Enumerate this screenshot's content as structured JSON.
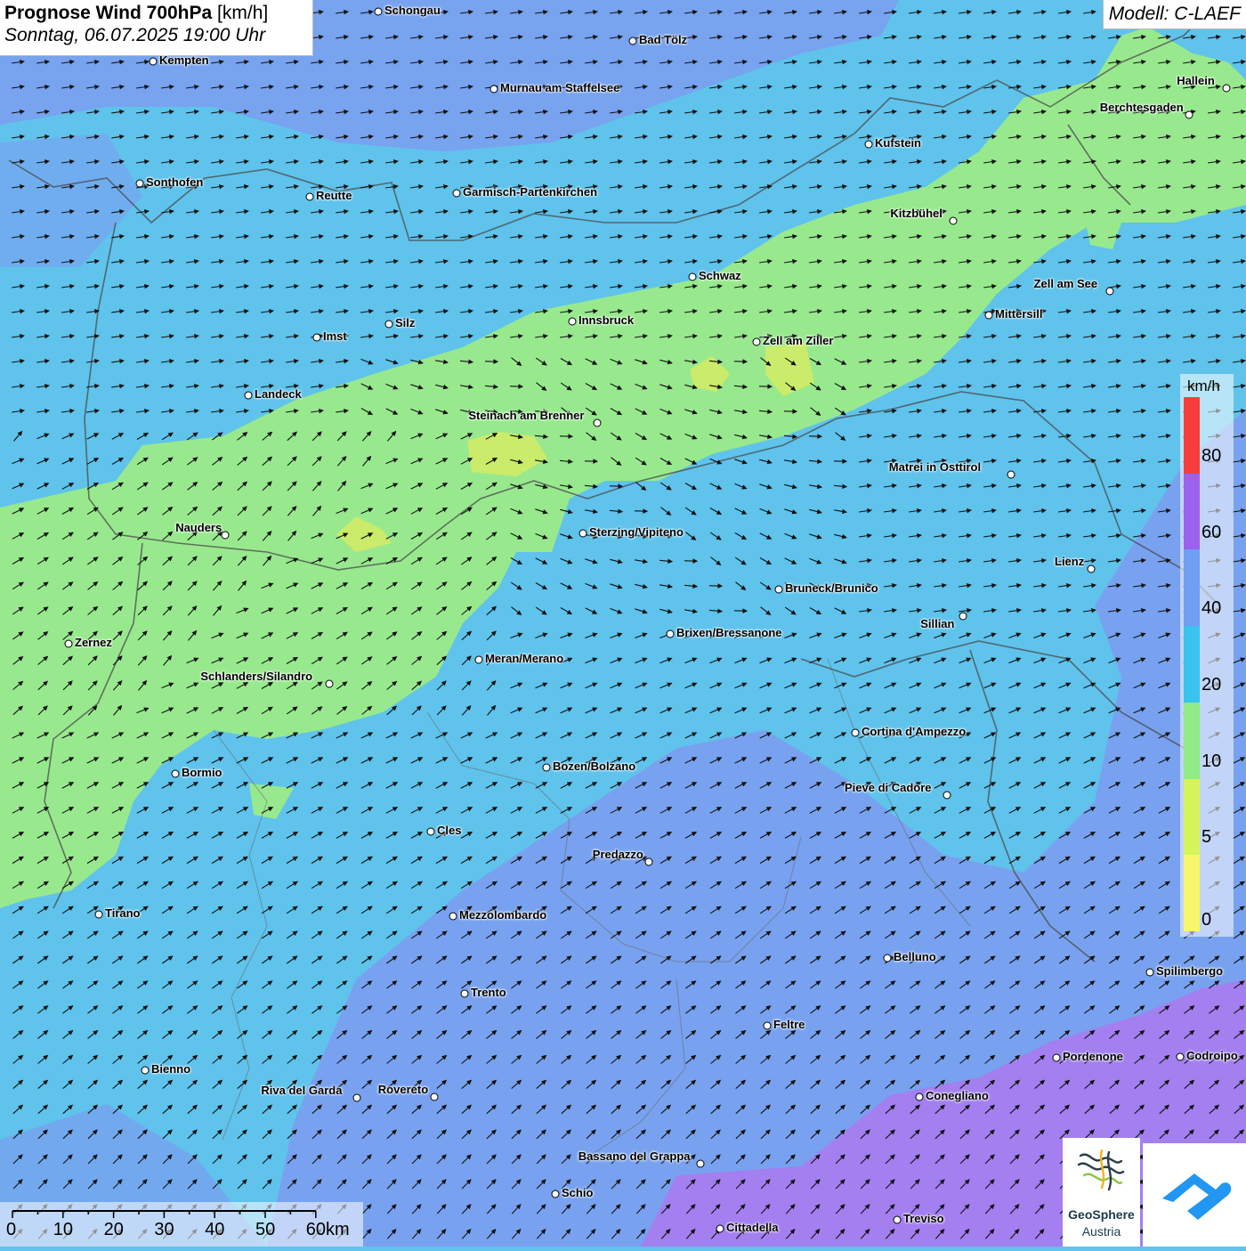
{
  "title": {
    "bold": "Prognose Wind 700hPa",
    "unit": "[km/h]",
    "date": "Sonntag, 06.07.2025 19:00 Uhr"
  },
  "model": "Modell: C-LAEF",
  "legend": {
    "unit": "km/h",
    "labels": [
      "80",
      "60",
      "40",
      "20",
      "10",
      "5",
      "0"
    ],
    "colors": [
      "#f73c3c",
      "#9a62ee",
      "#6f9ff2",
      "#39c4ef",
      "#8fec87",
      "#d5f55a",
      "#f8f66a"
    ]
  },
  "scale": {
    "labels": [
      "0",
      "10",
      "20",
      "30",
      "40",
      "50",
      "60km"
    ]
  },
  "background_colors": {
    "cyan": "#5fc3ec",
    "blue": "#7b9ef0",
    "green": "#98e98e",
    "yellowgreen": "#cbeb6a",
    "violet": "#a37ff0"
  },
  "cities": [
    {
      "name": "Schongau"
    },
    {
      "name": "Bad Tölz"
    },
    {
      "name": "Kempten"
    },
    {
      "name": "Murnau am Staffelsee"
    },
    {
      "name": "Hallein"
    },
    {
      "name": "Berchtesgaden"
    },
    {
      "name": "Kufstein"
    },
    {
      "name": "Sonthofen"
    },
    {
      "name": "Reutte"
    },
    {
      "name": "Garmisch-Partenkirchen"
    },
    {
      "name": "Kitzbühel"
    },
    {
      "name": "Schwaz"
    },
    {
      "name": "Zell am See"
    },
    {
      "name": "Innsbruck"
    },
    {
      "name": "Mittersill"
    },
    {
      "name": "Silz"
    },
    {
      "name": "Imst"
    },
    {
      "name": "Zell am Ziller"
    },
    {
      "name": "Landeck"
    },
    {
      "name": "Steinach am Brenner"
    },
    {
      "name": "Matrei in Osttirol"
    },
    {
      "name": "Nauders"
    },
    {
      "name": "Sterzing/Vipiteno"
    },
    {
      "name": "Lienz"
    },
    {
      "name": "Bruneck/Brunico"
    },
    {
      "name": "Sillian"
    },
    {
      "name": "Zernez"
    },
    {
      "name": "Brixen/Bressanone"
    },
    {
      "name": "Meran/Merano"
    },
    {
      "name": "Schlanders/Silandro"
    },
    {
      "name": "Cortina d'Ampezzo"
    },
    {
      "name": "Bozen/Bolzano"
    },
    {
      "name": "Bormio"
    },
    {
      "name": "Pieve di Cadore"
    },
    {
      "name": "Cles"
    },
    {
      "name": "Predazzo"
    },
    {
      "name": "Tirano"
    },
    {
      "name": "Mezzolombardo"
    },
    {
      "name": "Belluno"
    },
    {
      "name": "Spilimbergo"
    },
    {
      "name": "Trento"
    },
    {
      "name": "Feltre"
    },
    {
      "name": "Pordenone"
    },
    {
      "name": "Codroipo"
    },
    {
      "name": "Bienno"
    },
    {
      "name": "Riva del Garda"
    },
    {
      "name": "Rovereto"
    },
    {
      "name": "Conegliano"
    },
    {
      "name": "Bassano del Grappa"
    },
    {
      "name": "Schio"
    },
    {
      "name": "Treviso"
    },
    {
      "name": "Cittadella"
    }
  ],
  "logo": {
    "line1": "GeoSphere",
    "line2": "Austria"
  }
}
